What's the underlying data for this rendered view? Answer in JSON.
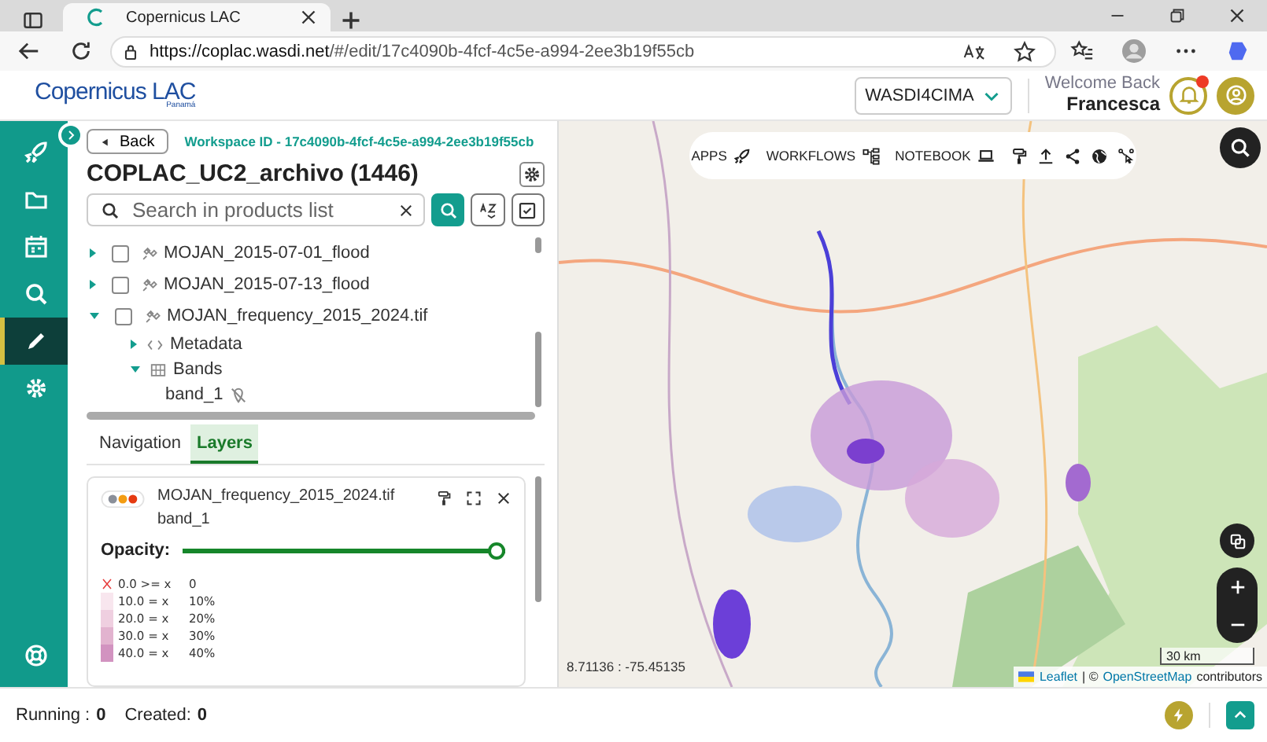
{
  "browser": {
    "tab_title": "Copernicus LAC",
    "url_host": "https://coplac.wasdi.net",
    "url_path": "/#/edit/17c4090b-4fcf-4c5e-a994-2ee3b19f55cb"
  },
  "header": {
    "logo": "Copernicus LAC",
    "logo_sub": "Panamá",
    "workspace_select": "WASDI4CIMA",
    "welcome": "Welcome Back",
    "user_name": "Francesca",
    "unread_notifications": true
  },
  "sidebar": {
    "items": [
      {
        "kind": "rocket",
        "selected": false
      },
      {
        "kind": "folder",
        "selected": false
      },
      {
        "kind": "calendar",
        "selected": false
      },
      {
        "kind": "search",
        "selected": false
      },
      {
        "kind": "pencil",
        "selected": true
      },
      {
        "kind": "gear",
        "selected": false
      }
    ],
    "bottom_item": {
      "kind": "lifebuoy"
    }
  },
  "panel": {
    "back": "Back",
    "workspace_id": "Workspace ID - 17c4090b-4fcf-4c5e-a994-2ee3b19f55cb",
    "title": "COPLAC_UC2_archivo (1446)",
    "search": {
      "placeholder": "Search in products list"
    },
    "products": [
      {
        "kind": "product",
        "label": "MOJAN_2015-07-01_flood",
        "expanded": false,
        "checked": false
      },
      {
        "kind": "product",
        "label": "MOJAN_2015-07-13_flood",
        "expanded": false,
        "checked": false
      },
      {
        "kind": "product",
        "label": "MOJAN_frequency_2015_2024.tif",
        "expanded": true,
        "checked": false,
        "children": [
          {
            "kind": "metadata",
            "label": "Metadata",
            "expanded": false
          },
          {
            "kind": "bands",
            "label": "Bands",
            "expanded": true,
            "children": [
              {
                "kind": "band",
                "label": "band_1"
              }
            ]
          }
        ]
      }
    ],
    "tabs": [
      {
        "label": "Navigation",
        "selected": false
      },
      {
        "label": "Layers",
        "selected": true
      }
    ],
    "layer": {
      "name": "MOJAN_frequency_2015_2024.tif",
      "band": "band_1",
      "opacity_label": "Opacity:",
      "opacity": {
        "level": 1.0
      },
      "legend": [
        {
          "kind": "nodata",
          "range": "0.0 >= x",
          "value": "0"
        },
        {
          "kind": "swatch",
          "range": "10.0 = x",
          "value": "10%",
          "color": "#f8e6ee"
        },
        {
          "kind": "swatch",
          "range": "20.0 = x",
          "value": "20%",
          "color": "#efcfe0"
        },
        {
          "kind": "swatch",
          "range": "30.0 = x",
          "value": "30%",
          "color": "#e2b3cf"
        },
        {
          "kind": "swatch",
          "range": "40.0 = x",
          "value": "40%",
          "color": "#d293c0"
        }
      ]
    }
  },
  "map": {
    "toolbar": [
      {
        "kind": "rocket",
        "label": "APPS"
      },
      {
        "kind": "workflow",
        "label": "WORKFLOWS"
      },
      {
        "kind": "laptop",
        "label": "NOTEBOOK"
      },
      {
        "kind": "roller"
      },
      {
        "kind": "upload"
      },
      {
        "kind": "share"
      },
      {
        "kind": "globe"
      },
      {
        "kind": "pointer"
      }
    ],
    "coordinates": "8.71136 : -75.45135",
    "scale": "30 km",
    "attribution_link1": "Leaflet",
    "attribution_sep": "| ©",
    "attribution_link2": "OpenStreetMap",
    "attribution_tail": "contributors"
  },
  "status_bar": {
    "running_label": "Running :",
    "running": "0",
    "created_label": "Created:",
    "created": "0"
  }
}
